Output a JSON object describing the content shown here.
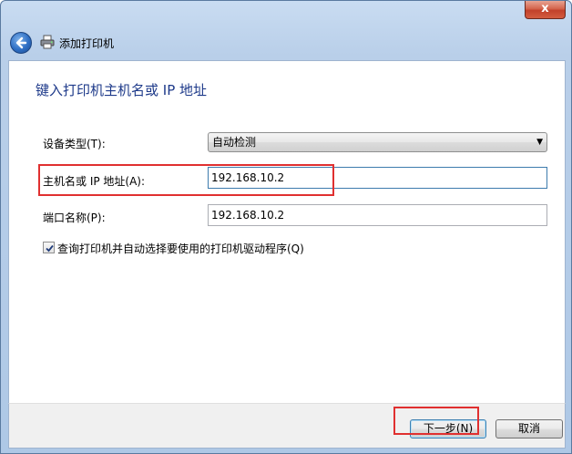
{
  "window": {
    "title": "添加打印机",
    "close_label": "x"
  },
  "heading": "键入打印机主机名或 IP 地址",
  "form": {
    "device_type_label": "设备类型(T):",
    "device_type_value": "自动检测",
    "hostname_label": "主机名或 IP 地址(A):",
    "hostname_value": "192.168.10.2",
    "port_label": "端口名称(P):",
    "port_value": "192.168.10.2",
    "auto_driver_label": "查询打印机并自动选择要使用的打印机驱动程序(Q)",
    "auto_driver_checked": true
  },
  "buttons": {
    "next_label": "下一步(N)",
    "cancel_label": "取消"
  },
  "colors": {
    "annotation_red": "#e03030",
    "heading_blue": "#1e3a8a"
  }
}
